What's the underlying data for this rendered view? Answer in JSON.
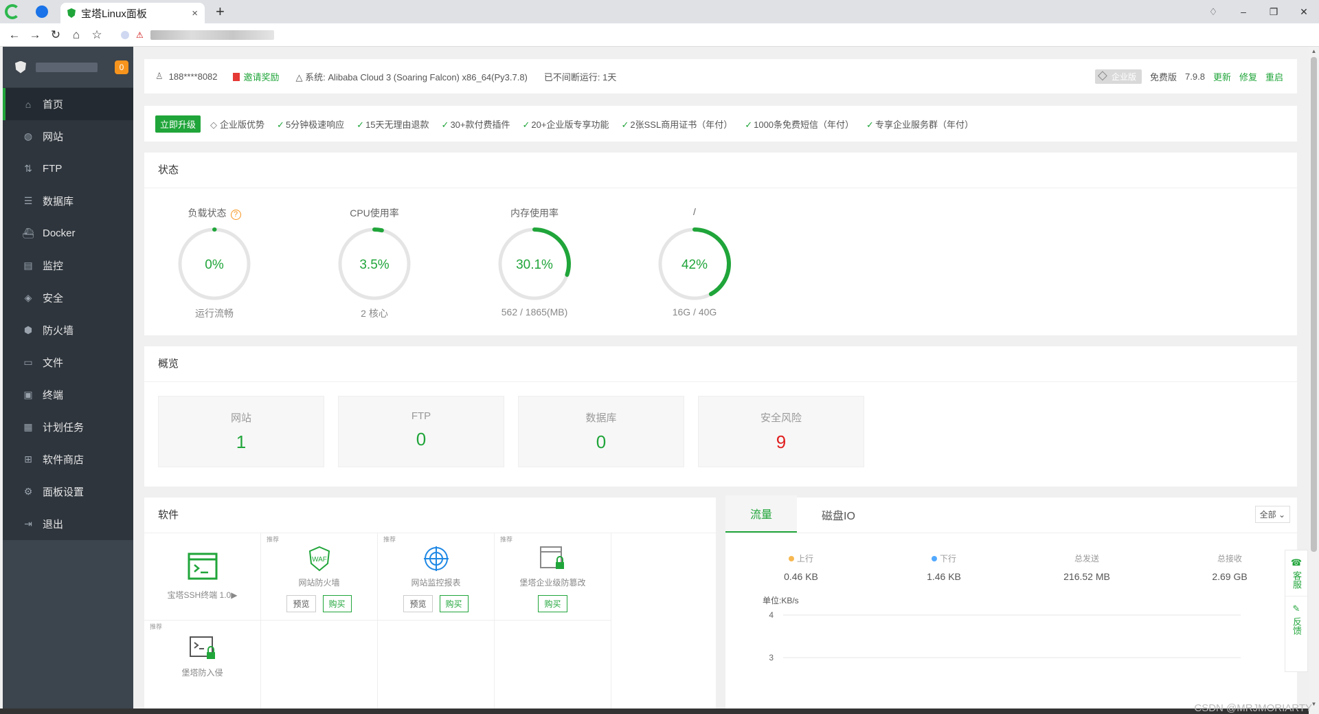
{
  "browser": {
    "tab_title": "宝塔Linux面板",
    "close_glyph": "×",
    "new_tab_glyph": "+"
  },
  "header": {
    "phone": "188****8082",
    "invite": "邀请奖励",
    "system_label": "系统:",
    "system_value": "Alibaba Cloud 3 (Soaring Falcon) x86_64(Py3.7.8)",
    "uptime": "已不间断运行: 1天",
    "enterprise_tag": "企业版",
    "edition": "免费版",
    "version": "7.9.8",
    "update": "更新",
    "repair": "修复",
    "restart": "重启"
  },
  "promo": {
    "upgrade": "立即升级",
    "enterprise_adv": "企业版优势",
    "features": [
      "5分钟极速响应",
      "15天无理由退款",
      "30+款付费插件",
      "20+企业版专享功能",
      "2张SSL商用证书（年付）",
      "1000条免费短信（年付）",
      "专享企业服务群（年付）"
    ]
  },
  "sidebar": {
    "badge": "0",
    "items": [
      {
        "label": "首页",
        "icon": "home-icon",
        "glyph": "⌂"
      },
      {
        "label": "网站",
        "icon": "globe-icon",
        "glyph": "◍"
      },
      {
        "label": "FTP",
        "icon": "ftp-icon",
        "glyph": "⇅"
      },
      {
        "label": "数据库",
        "icon": "database-icon",
        "glyph": "☰"
      },
      {
        "label": "Docker",
        "icon": "docker-icon",
        "glyph": "⛴"
      },
      {
        "label": "监控",
        "icon": "monitor-icon",
        "glyph": "▤"
      },
      {
        "label": "安全",
        "icon": "shield-icon",
        "glyph": "◈"
      },
      {
        "label": "防火墙",
        "icon": "firewall-icon",
        "glyph": "⬢"
      },
      {
        "label": "文件",
        "icon": "folder-icon",
        "glyph": "▭"
      },
      {
        "label": "终端",
        "icon": "terminal-icon",
        "glyph": "▣"
      },
      {
        "label": "计划任务",
        "icon": "calendar-icon",
        "glyph": "▦"
      },
      {
        "label": "软件商店",
        "icon": "apps-icon",
        "glyph": "⊞"
      },
      {
        "label": "面板设置",
        "icon": "gear-icon",
        "glyph": "⚙"
      },
      {
        "label": "退出",
        "icon": "logout-icon",
        "glyph": "⇥"
      }
    ]
  },
  "status": {
    "title": "状态",
    "help_glyph": "?",
    "gauges": [
      {
        "label": "负载状态",
        "value": "0%",
        "percent": 0,
        "sub": "运行流畅",
        "help": true
      },
      {
        "label": "CPU使用率",
        "value": "3.5%",
        "percent": 3.5,
        "sub": "2 核心",
        "help": false
      },
      {
        "label": "内存使用率",
        "value": "30.1%",
        "percent": 30.1,
        "sub": "562 / 1865(MB)",
        "help": false
      },
      {
        "label": "/",
        "value": "42%",
        "percent": 42,
        "sub": "16G / 40G",
        "help": false
      }
    ],
    "accent": "#20a53a"
  },
  "overview": {
    "title": "概览",
    "cards": [
      {
        "label": "网站",
        "value": "1"
      },
      {
        "label": "FTP",
        "value": "0"
      },
      {
        "label": "数据库",
        "value": "0"
      },
      {
        "label": "安全风险",
        "value": "9"
      }
    ]
  },
  "software": {
    "title": "软件",
    "recommend": "推荐",
    "preview": "预览",
    "buy": "购买",
    "items": [
      {
        "name": "宝塔SSH终端 1.0▶"
      },
      {
        "name": "网站防火墙"
      },
      {
        "name": "网站监控报表"
      },
      {
        "name": "堡塔企业级防篡改"
      },
      {
        "name": "堡塔防入侵"
      }
    ]
  },
  "traffic": {
    "tabs": [
      "流量",
      "磁盘IO"
    ],
    "select": "全部",
    "stats": [
      {
        "label": "上行",
        "value": "0.46 KB",
        "color": "#f7b851"
      },
      {
        "label": "下行",
        "value": "1.46 KB",
        "color": "#52a9ff"
      },
      {
        "label": "总发送",
        "value": "216.52 MB"
      },
      {
        "label": "总接收",
        "value": "2.69 GB"
      }
    ],
    "unit": "单位:KB/s",
    "yticks": [
      "4",
      "3"
    ]
  },
  "float_tools": {
    "service": "客服",
    "feedback": "反馈"
  },
  "watermark": "CSDN @MRJMORIARTY"
}
